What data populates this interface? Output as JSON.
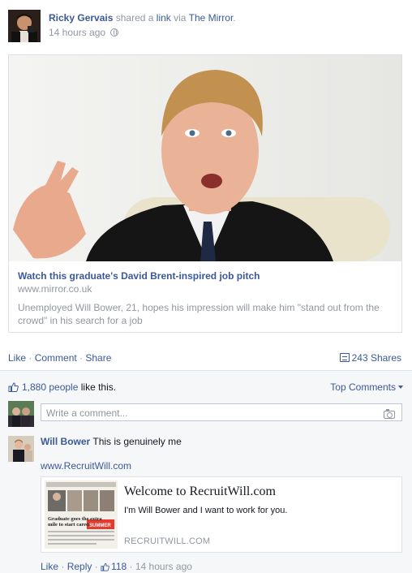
{
  "header": {
    "name": "Ricky Gervais",
    "shared_text": "shared a",
    "link_word": "link",
    "via_text": "via",
    "source": "The Mirror",
    "period": ".",
    "time": "14 hours ago",
    "privacy_icon": "globe-icon"
  },
  "card": {
    "title": "Watch this graduate's David Brent-inspired job pitch",
    "domain": "www.mirror.co.uk",
    "description": "Unemployed Will Bower, 21, hopes his impression will make him \"stand out from the crowd\" in his search for a job"
  },
  "actions": {
    "like": "Like",
    "comment": "Comment",
    "share": "Share",
    "dot": " · ",
    "shares_count": "243 Shares"
  },
  "ufi": {
    "likes_count": "1,880 people",
    "likes_suffix": "like this.",
    "top_comments": "Top Comments",
    "comment_placeholder": "Write a comment..."
  },
  "comment": {
    "author": "Will Bower",
    "text": "This is genuinely me",
    "url": "www.RecruitWill.com",
    "preview": {
      "title": "Welcome to RecruitWill.com",
      "description": "I'm Will Bower and I want to work for you.",
      "domain": "RECRUITWILL.COM",
      "thumb_caption_line1": "Graduate goes the extra",
      "thumb_caption_line2": "mile to start career",
      "thumb_caption_line3": "SUMMER"
    },
    "like": "Like",
    "reply": "Reply",
    "like_count": "118",
    "time": "14 hours ago"
  },
  "colors": {
    "link_blue": "#3b5998",
    "meta_gray": "#9197a3",
    "ufi_bg": "#f6f7f8"
  }
}
